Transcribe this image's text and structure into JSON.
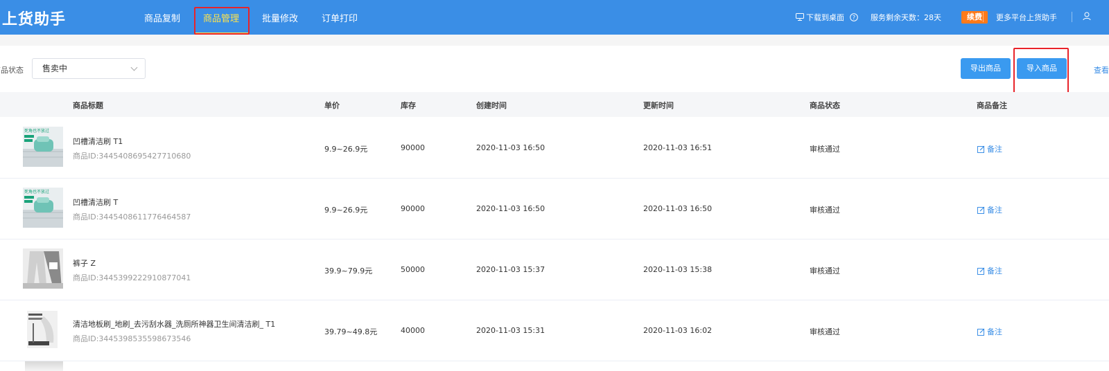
{
  "app": {
    "logo": "上货助手"
  },
  "nav": {
    "items": [
      {
        "label": "商品复制"
      },
      {
        "label": "商品管理"
      },
      {
        "label": "批量修改"
      },
      {
        "label": "订单打印"
      }
    ]
  },
  "topright": {
    "download": "下载到桌面",
    "days": "服务剩余天数：28天",
    "renew": "续费",
    "more": "更多平台上货助手"
  },
  "filter": {
    "label": "商品状态",
    "select_value": "售卖中"
  },
  "actions": {
    "export": "导出商品",
    "import": "导入商品",
    "view": "查看"
  },
  "table": {
    "columns": [
      "商品标题",
      "单价",
      "库存",
      "创建时间",
      "更新时间",
      "商品状态",
      "商品备注"
    ],
    "rows": [
      {
        "title": "凹槽清洁刷 T1",
        "id": "商品ID:3445408695427710680",
        "price": "9.9~26.9元",
        "stock": "90000",
        "created": "2020-11-03 16:50",
        "updated": "2020-11-03 16:51",
        "status": "审核通过",
        "note": "备注",
        "thumb": "brush",
        "thumb_text": "死角也不放过"
      },
      {
        "title": "凹槽清洁刷 T",
        "id": "商品ID:3445408611776464587",
        "price": "9.9~26.9元",
        "stock": "90000",
        "created": "2020-11-03 16:50",
        "updated": "2020-11-03 16:50",
        "status": "审核通过",
        "note": "备注",
        "thumb": "brush",
        "thumb_text": "死角也不放过"
      },
      {
        "title": "裤子 Z",
        "id": "商品ID:3445399222910877041",
        "price": "39.9~79.9元",
        "stock": "50000",
        "created": "2020-11-03 15:37",
        "updated": "2020-11-03 15:38",
        "status": "审核通过",
        "note": "备注",
        "thumb": "pants",
        "thumb_text": ""
      },
      {
        "title": "清洁地板刷_地刷_去污刮水器_洗厕所神器卫生间清洁刷_ T1",
        "id": "商品ID:3445398535598673546",
        "price": "39.79~49.8元",
        "stock": "40000",
        "created": "2020-11-03 15:31",
        "updated": "2020-11-03 16:02",
        "status": "审核通过",
        "note": "备注",
        "thumb": "mop",
        "thumb_text": ""
      }
    ]
  },
  "colors": {
    "topbar": "#3a8ee6",
    "active_nav": "#ffe44d",
    "highlight": "#e8232a",
    "button": "#3a9af0",
    "renew": "#ff7a1a"
  }
}
